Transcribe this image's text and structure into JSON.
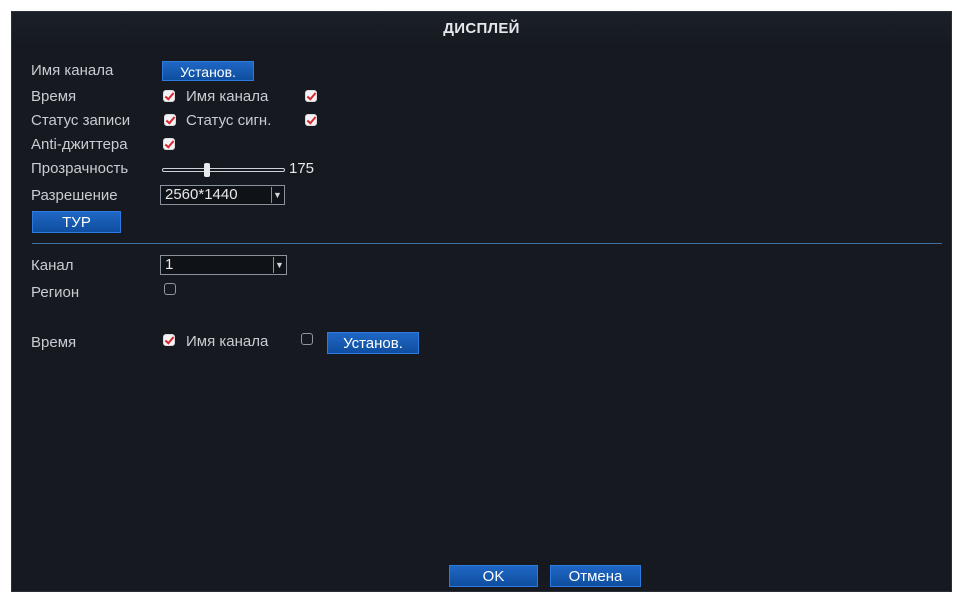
{
  "window": {
    "title": "ДИСПЛЕЙ"
  },
  "top": {
    "channel_name_label": "Имя канала",
    "channel_name_button": "Установ.",
    "time_label": "Время",
    "time_checked": true,
    "time_channel_name_label": "Имя канала",
    "time_channel_name_checked": true,
    "record_status_label": "Статус записи",
    "record_status_checked": true,
    "signal_status_label": "Статус сигн.",
    "signal_status_checked": true,
    "anti_jitter_label": "Anti-джиттера",
    "anti_jitter_checked": true,
    "transparency_label": "Прозрачность",
    "transparency_value": "175",
    "resolution_label": "Разрешение",
    "resolution_value": "2560*1440",
    "tour_button": "ТУР"
  },
  "bottom": {
    "channel_label": "Канал",
    "channel_value": "1",
    "region_label": "Регион",
    "region_checked": false,
    "time_label": "Время",
    "time_checked": true,
    "channel_name_label": "Имя канала",
    "channel_name_checked": false,
    "set_button": "Установ."
  },
  "footer": {
    "ok_button": "OK",
    "cancel_button": "Отмена"
  },
  "colors": {
    "background": "#16191f",
    "button": "#1a5fb8",
    "check_mark": "#d8252e",
    "divider": "#3f6f9e"
  }
}
